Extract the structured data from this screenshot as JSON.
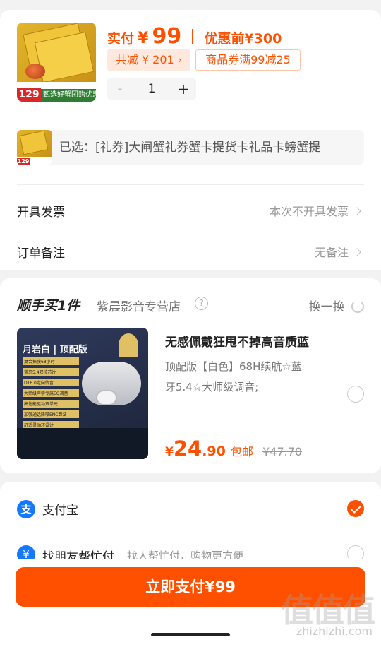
{
  "item": {
    "thumb_price": "129",
    "thumb_caption": "甄选好蟹团购优惠",
    "price_label": "实付",
    "currency": "¥",
    "price": "99",
    "pre_discount": "优惠前¥300",
    "total_discount": "共减 ¥ 201 ›",
    "coupon": "商品券满99减25",
    "qty_minus": "-",
    "qty": "1",
    "qty_plus": "+"
  },
  "selected": {
    "text": "已选：[礼券]大闸蟹礼券蟹卡提货卡礼品卡螃蟹提"
  },
  "invoice": {
    "label": "开具发票",
    "value": "本次不开具发票"
  },
  "remark": {
    "label": "订单备注",
    "value": "无备注"
  },
  "addon": {
    "title": "顺手买1件",
    "store": "紫晨影音专营店",
    "help_icon": "?",
    "refresh": "换一换",
    "img_title": "月岩白 | 顶配版",
    "img_features": [
      "复合振膜68小时",
      "蓝牙5.4双核芯片",
      "DT6.0定向传音",
      "大师级声学专属EQ调音",
      "高性能驱动双单元",
      "加强通话降噪ENC算法",
      "舒适灵动环设计"
    ],
    "product_title": "无感佩戴狂甩不掉高音质蓝",
    "spec_line1": "顶配版【白色】68H续航☆蓝",
    "spec_line2": "牙5.4☆大师级调音;",
    "price_currency": "¥",
    "price_int": "24",
    "price_dec": ".90",
    "free_ship": "包邮",
    "orig_price": "¥47.70"
  },
  "payment": {
    "alipay_label": "支付宝",
    "friend_label": "找朋友帮忙付",
    "friend_desc": "找人帮忙付，购物更方便"
  },
  "pay_button": "立即支付¥99",
  "watermark": {
    "cn": "值值值",
    "en": "zhizhizhi.com"
  },
  "colors": {
    "accent": "#ff5000",
    "alipay": "#1677ff"
  }
}
